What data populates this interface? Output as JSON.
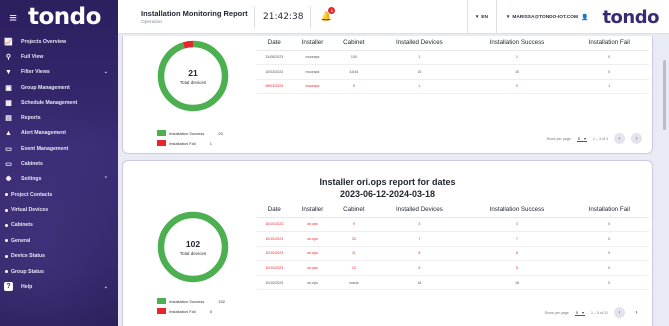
{
  "sidebar": {
    "logo": "tondo",
    "items": [
      {
        "label": "Projects Overview",
        "icon": "chart-line-icon",
        "glyph": "📈"
      },
      {
        "label": "Full View",
        "icon": "map-pin-icon",
        "glyph": "⚲"
      },
      {
        "label": "Filter Views",
        "icon": "filter-icon",
        "glyph": "▼",
        "chevron": "﹀"
      },
      {
        "label": "Group Management",
        "icon": "group-icon",
        "glyph": "▣"
      },
      {
        "label": "Schedule Management",
        "icon": "calendar-icon",
        "glyph": "▦"
      },
      {
        "label": "Reports",
        "icon": "document-icon",
        "glyph": "▤"
      },
      {
        "label": "Alert Management",
        "icon": "alert-icon",
        "glyph": "▲"
      },
      {
        "label": "Event Management",
        "icon": "event-icon",
        "glyph": "▭"
      },
      {
        "label": "Cabinets",
        "icon": "cabinet-icon",
        "glyph": "▭"
      },
      {
        "label": "Settings",
        "icon": "gear-icon",
        "glyph": "✹",
        "chevron": "︿"
      }
    ],
    "sub_items": [
      "Project Contacts",
      "Virtual Devices",
      "Cabinets",
      "General",
      "Device Status",
      "Group Status"
    ],
    "help": {
      "label": "Help",
      "icon": "help-icon",
      "glyph": "?",
      "chevron": "﹀"
    }
  },
  "header": {
    "title": "Installation Monitoring Report",
    "subtitle": "Operation",
    "time": "21:42:38",
    "notification_count": "1",
    "language": "EN",
    "user": "MARISSA@TONDO-IOT.COM",
    "logo": "tondo"
  },
  "columns": [
    "Date",
    "Installer",
    "Cabinet",
    "Installed Devices",
    "Installation Success",
    "Installation Fail"
  ],
  "report1": {
    "total": "21",
    "total_label": "Total devices",
    "success_fraction": 0.952,
    "legend": [
      {
        "label": "Installation Success",
        "count": "20",
        "color": "#4caf50"
      },
      {
        "label": "Installation Fail",
        "count": "1",
        "color": "#e5262c"
      }
    ],
    "rows": [
      {
        "date": "31/08/2023",
        "installer": "mooraps",
        "cabinet": "100",
        "installed": "1",
        "success": "1",
        "fail": "0",
        "error": false
      },
      {
        "date": "10/03/2023",
        "installer": "mooraps",
        "cabinet": "43/44",
        "installed": "15",
        "success": "15",
        "fail": "0",
        "error": false
      },
      {
        "date": "09/03/2024",
        "installer": "mooraps",
        "cabinet": "9",
        "installed": "1",
        "success": "0",
        "fail": "1",
        "error": true
      }
    ],
    "pager": {
      "rows_per_page_label": "Rows per page",
      "rows_per_page": "5",
      "range": "1 – 3 of 3"
    }
  },
  "report2": {
    "title": "Installer ori.ops report for dates",
    "dates": "2023-06-12-2024-03-18",
    "total": "102",
    "total_label": "Total devices",
    "success_fraction": 1.0,
    "legend": [
      {
        "label": "Installation Success",
        "count": "102",
        "color": "#4caf50"
      },
      {
        "label": "Installation Fail",
        "count": "0",
        "color": "#e5262c"
      }
    ],
    "rows": [
      {
        "date": "10/10/2023",
        "installer": "ori.ops",
        "cabinet": "9",
        "installed": "3",
        "success": "3",
        "fail": "0",
        "error": true
      },
      {
        "date": "10/10/2023",
        "installer": "ori.ops",
        "cabinet": "33",
        "installed": "7",
        "success": "7",
        "fail": "0",
        "error": true
      },
      {
        "date": "10/10/2023",
        "installer": "ori.ops",
        "cabinet": "11",
        "installed": "8",
        "success": "8",
        "fail": "0",
        "error": true
      },
      {
        "date": "10/10/2023",
        "installer": "ori.ops",
        "cabinet": "12",
        "installed": "5",
        "success": "5",
        "fail": "0",
        "error": true
      },
      {
        "date": "10/10/2023",
        "installer": "ori.ops",
        "cabinet": "mavis",
        "installed": "18",
        "success": "18",
        "fail": "0",
        "error": false
      }
    ],
    "pager": {
      "rows_per_page_label": "Rows per page",
      "rows_per_page": "5",
      "range": "1 – 5 of 21"
    }
  }
}
